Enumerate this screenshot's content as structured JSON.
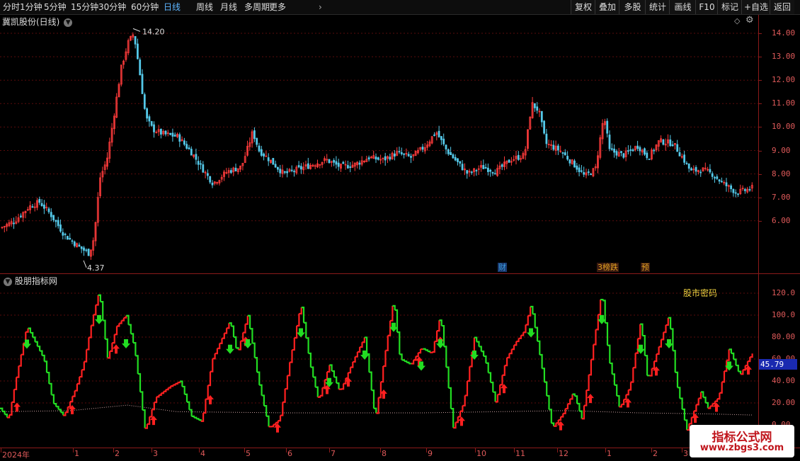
{
  "toolbar": {
    "periods": [
      "分时",
      "1分钟",
      "5分钟",
      "15分钟",
      "30分钟",
      "60分钟",
      "日线",
      "周线",
      "月线",
      "多周期",
      "更多"
    ],
    "active_period": "日线",
    "right_buttons": [
      "复权",
      "叠加",
      "多股",
      "统计",
      "画线",
      "F10",
      "标记",
      "+自选",
      "返回"
    ]
  },
  "main": {
    "title": "冀凯股份(日线)",
    "high_label": "14.20",
    "low_label": "4.37",
    "y_ticks": [
      "14.00",
      "13.00",
      "12.00",
      "11.00",
      "10.00",
      "9.00",
      "8.00",
      "7.00",
      "6.00"
    ],
    "badges": [
      {
        "text": "财",
        "color": "#3a9ad9"
      },
      {
        "text": "3榜跌",
        "color": "#e0a020"
      },
      {
        "text": "预",
        "color": "#e0a020"
      }
    ],
    "colors": {
      "up": "#ff3b3b",
      "down": "#54c8e8",
      "grid": "#6b1010"
    }
  },
  "sub": {
    "title": "股朋指标网",
    "indicator_label": "股市密码",
    "current_value": "45.79",
    "y_ticks": [
      "120.0",
      "100.0",
      "80.00",
      "60.00",
      "40.00",
      "20.00",
      "0.00"
    ],
    "colors": {
      "rise": "#ff2020",
      "fall": "#22dd22",
      "value_box": "#1a2ab0"
    }
  },
  "date_axis": {
    "labels": [
      "2024年",
      "1",
      "2",
      "3",
      "4",
      "5",
      "6",
      "7",
      "8",
      "9",
      "10",
      "11",
      "12",
      "1",
      "2",
      "3"
    ]
  },
  "watermark": {
    "line1": "指标公式网",
    "line2": "www.zbgs3.com"
  },
  "chart_data": [
    {
      "type": "candlestick",
      "title": "冀凯股份(日线)",
      "ylim": [
        5.5,
        14.5
      ],
      "y_ticks": [
        14,
        13,
        12,
        11,
        10,
        9,
        8,
        7,
        6
      ],
      "annotations": [
        {
          "label": "14.20",
          "value": 14.2
        },
        {
          "label": "4.37",
          "value": 4.37
        }
      ],
      "close_path": [
        [
          0,
          5.7
        ],
        [
          20,
          6.0
        ],
        [
          40,
          6.6
        ],
        [
          55,
          6.8
        ],
        [
          70,
          6.3
        ],
        [
          90,
          5.4
        ],
        [
          110,
          4.9
        ],
        [
          125,
          4.6
        ],
        [
          132,
          5.3
        ],
        [
          140,
          7.8
        ],
        [
          150,
          8.6
        ],
        [
          160,
          10.5
        ],
        [
          170,
          12.5
        ],
        [
          180,
          13.6
        ],
        [
          188,
          14.0
        ],
        [
          196,
          12.4
        ],
        [
          205,
          10.4
        ],
        [
          215,
          9.9
        ],
        [
          230,
          9.7
        ],
        [
          250,
          9.6
        ],
        [
          270,
          8.9
        ],
        [
          290,
          8.0
        ],
        [
          300,
          7.6
        ],
        [
          320,
          8.1
        ],
        [
          340,
          8.3
        ],
        [
          350,
          9.2
        ],
        [
          356,
          9.8
        ],
        [
          365,
          9.0
        ],
        [
          380,
          8.6
        ],
        [
          400,
          8.0
        ],
        [
          420,
          8.2
        ],
        [
          440,
          8.4
        ],
        [
          460,
          8.6
        ],
        [
          480,
          8.3
        ],
        [
          500,
          8.4
        ],
        [
          520,
          8.7
        ],
        [
          540,
          8.6
        ],
        [
          560,
          8.9
        ],
        [
          580,
          8.7
        ],
        [
          600,
          9.2
        ],
        [
          615,
          9.8
        ],
        [
          630,
          9.0
        ],
        [
          645,
          8.5
        ],
        [
          660,
          8.0
        ],
        [
          680,
          8.3
        ],
        [
          700,
          8.1
        ],
        [
          720,
          8.6
        ],
        [
          740,
          8.8
        ],
        [
          750,
          11.0
        ],
        [
          760,
          10.7
        ],
        [
          770,
          9.3
        ],
        [
          790,
          9.0
        ],
        [
          810,
          8.4
        ],
        [
          825,
          7.9
        ],
        [
          840,
          8.2
        ],
        [
          852,
          10.5
        ],
        [
          860,
          9.0
        ],
        [
          880,
          8.8
        ],
        [
          900,
          9.2
        ],
        [
          915,
          8.7
        ],
        [
          930,
          9.4
        ],
        [
          950,
          9.3
        ],
        [
          965,
          8.6
        ],
        [
          975,
          8.1
        ],
        [
          990,
          8.2
        ],
        [
          1005,
          8.0
        ],
        [
          1020,
          7.6
        ],
        [
          1040,
          7.2
        ],
        [
          1062,
          7.4
        ]
      ]
    },
    {
      "type": "line",
      "title": "股朋指标网",
      "ylim": [
        0,
        125
      ],
      "y_ticks": [
        120,
        100,
        80,
        60,
        40,
        20,
        0
      ],
      "series": [
        {
          "name": "股市密码",
          "last_value": 45.79,
          "path": [
            [
              0,
              15
            ],
            [
              12,
              5
            ],
            [
              22,
              40
            ],
            [
              38,
              90
            ],
            [
              50,
              75
            ],
            [
              62,
              60
            ],
            [
              75,
              20
            ],
            [
              90,
              8
            ],
            [
              105,
              30
            ],
            [
              118,
              55
            ],
            [
              130,
              95
            ],
            [
              140,
              122
            ],
            [
              152,
              60
            ],
            [
              165,
              90
            ],
            [
              178,
              100
            ],
            [
              190,
              70
            ],
            [
              205,
              -5
            ],
            [
              220,
              25
            ],
            [
              240,
              35
            ],
            [
              255,
              40
            ],
            [
              270,
              8
            ],
            [
              285,
              3
            ],
            [
              300,
              60
            ],
            [
              325,
              95
            ],
            [
              335,
              65
            ],
            [
              350,
              100
            ],
            [
              365,
              40
            ],
            [
              380,
              -3
            ],
            [
              395,
              5
            ],
            [
              410,
              60
            ],
            [
              425,
              110
            ],
            [
              438,
              55
            ],
            [
              450,
              22
            ],
            [
              465,
              55
            ],
            [
              480,
              30
            ],
            [
              500,
              60
            ],
            [
              515,
              80
            ],
            [
              530,
              5
            ],
            [
              545,
              70
            ],
            [
              556,
              115
            ],
            [
              565,
              60
            ],
            [
              580,
              55
            ],
            [
              595,
              70
            ],
            [
              610,
              65
            ],
            [
              622,
              100
            ],
            [
              640,
              -3
            ],
            [
              655,
              20
            ],
            [
              670,
              80
            ],
            [
              685,
              60
            ],
            [
              700,
              20
            ],
            [
              715,
              60
            ],
            [
              728,
              75
            ],
            [
              740,
              85
            ],
            [
              750,
              110
            ],
            [
              762,
              65
            ],
            [
              780,
              -3
            ],
            [
              795,
              10
            ],
            [
              810,
              30
            ],
            [
              822,
              5
            ],
            [
              835,
              60
            ],
            [
              850,
              122
            ],
            [
              860,
              60
            ],
            [
              875,
              15
            ],
            [
              890,
              35
            ],
            [
              905,
              95
            ],
            [
              915,
              40
            ],
            [
              930,
              70
            ],
            [
              945,
              100
            ],
            [
              955,
              40
            ],
            [
              970,
              -5
            ],
            [
              990,
              30
            ],
            [
              1000,
              15
            ],
            [
              1015,
              25
            ],
            [
              1030,
              70
            ],
            [
              1045,
              45
            ],
            [
              1062,
              65
            ]
          ]
        },
        {
          "name": "baseline",
          "path": [
            [
              0,
              12
            ],
            [
              100,
              13
            ],
            [
              180,
              18
            ],
            [
              250,
              12
            ],
            [
              400,
              11
            ],
            [
              600,
              11
            ],
            [
              800,
              13
            ],
            [
              900,
              11
            ],
            [
              1000,
              10
            ],
            [
              1062,
              9
            ]
          ]
        }
      ]
    }
  ]
}
